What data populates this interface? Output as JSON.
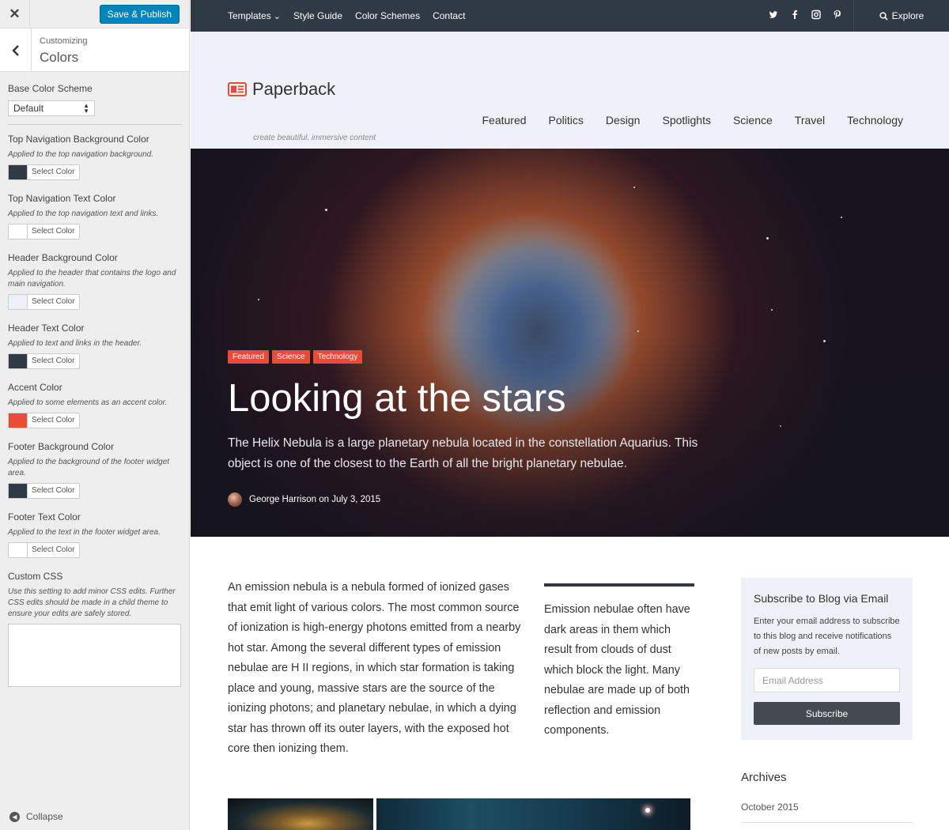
{
  "customizer": {
    "save_label": "Save & Publish",
    "crumb": "Customizing",
    "section_title": "Colors",
    "base_scheme": {
      "label": "Base Color Scheme",
      "value": "Default"
    },
    "options": [
      {
        "label": "Top Navigation Background Color",
        "desc": "Applied to the top navigation background.",
        "button": "Select Color",
        "color": "#2f3a45"
      },
      {
        "label": "Top Navigation Text Color",
        "desc": "Applied to the top navigation text and links.",
        "button": "Select Color",
        "color": "#ffffff"
      },
      {
        "label": "Header Background Color",
        "desc": "Applied to the header that contains the logo and main navigation.",
        "button": "Select Color",
        "color": "#eef2f8"
      },
      {
        "label": "Header Text Color",
        "desc": "Applied to text and links in the header.",
        "button": "Select Color",
        "color": "#2f3a45"
      },
      {
        "label": "Accent Color",
        "desc": "Applied to some elements as an accent color.",
        "button": "Select Color",
        "color": "#e94b36"
      },
      {
        "label": "Footer Background Color",
        "desc": "Applied to the background of the footer widget area.",
        "button": "Select Color",
        "color": "#2f3a45"
      },
      {
        "label": "Footer Text Color",
        "desc": "Applied to the text in the footer widget area.",
        "button": "Select Color",
        "color": "#ffffff"
      }
    ],
    "custom_css": {
      "label": "Custom CSS",
      "desc": "Use this setting to add minor CSS edits. Further CSS edits should be made in a child theme to ensure your edits are safely stored."
    },
    "collapse_label": "Collapse"
  },
  "site": {
    "topnav": {
      "items": [
        "Templates",
        "Style Guide",
        "Color Schemes",
        "Contact"
      ],
      "explore": "Explore",
      "social_icons": [
        "twitter-icon",
        "facebook-icon",
        "instagram-icon",
        "pinterest-icon"
      ]
    },
    "logo": {
      "name": "Paperback",
      "tagline": "create beautiful, immersive content"
    },
    "mainnav": [
      "Featured",
      "Politics",
      "Design",
      "Spotlights",
      "Science",
      "Travel",
      "Technology"
    ],
    "hero": {
      "tags": [
        "Featured",
        "Science",
        "Technology"
      ],
      "title": "Looking at the stars",
      "excerpt": "The Helix Nebula is a large planetary nebula located in the constellation Aquarius. This object is one of the closest to the Earth of all the bright planetary nebulae.",
      "byline": "George Harrison on July 3, 2015"
    },
    "article": "An emission nebula is a nebula formed of ionized gases that emit light of various colors. The most common source of ionization is high-energy photons emitted from a nearby hot star. Among the several different types of emission nebulae are H II regions, in which star formation is taking place and young, massive stars are the source of the ionizing photons; and planetary nebulae, in which a dying star has thrown off its outer layers, with the exposed hot core then ionizing them.",
    "pullquote": "Emission nebulae often have dark areas in them which result from clouds of dust which block the light. Many nebulae are made up of both reflection and emission components.",
    "widget": {
      "title": "Subscribe to Blog via Email",
      "desc": "Enter your email address to subscribe to this blog and receive notifications of new posts by email.",
      "placeholder": "Email Address",
      "button": "Subscribe"
    },
    "archives": {
      "title": "Archives",
      "item": "October 2015"
    }
  }
}
